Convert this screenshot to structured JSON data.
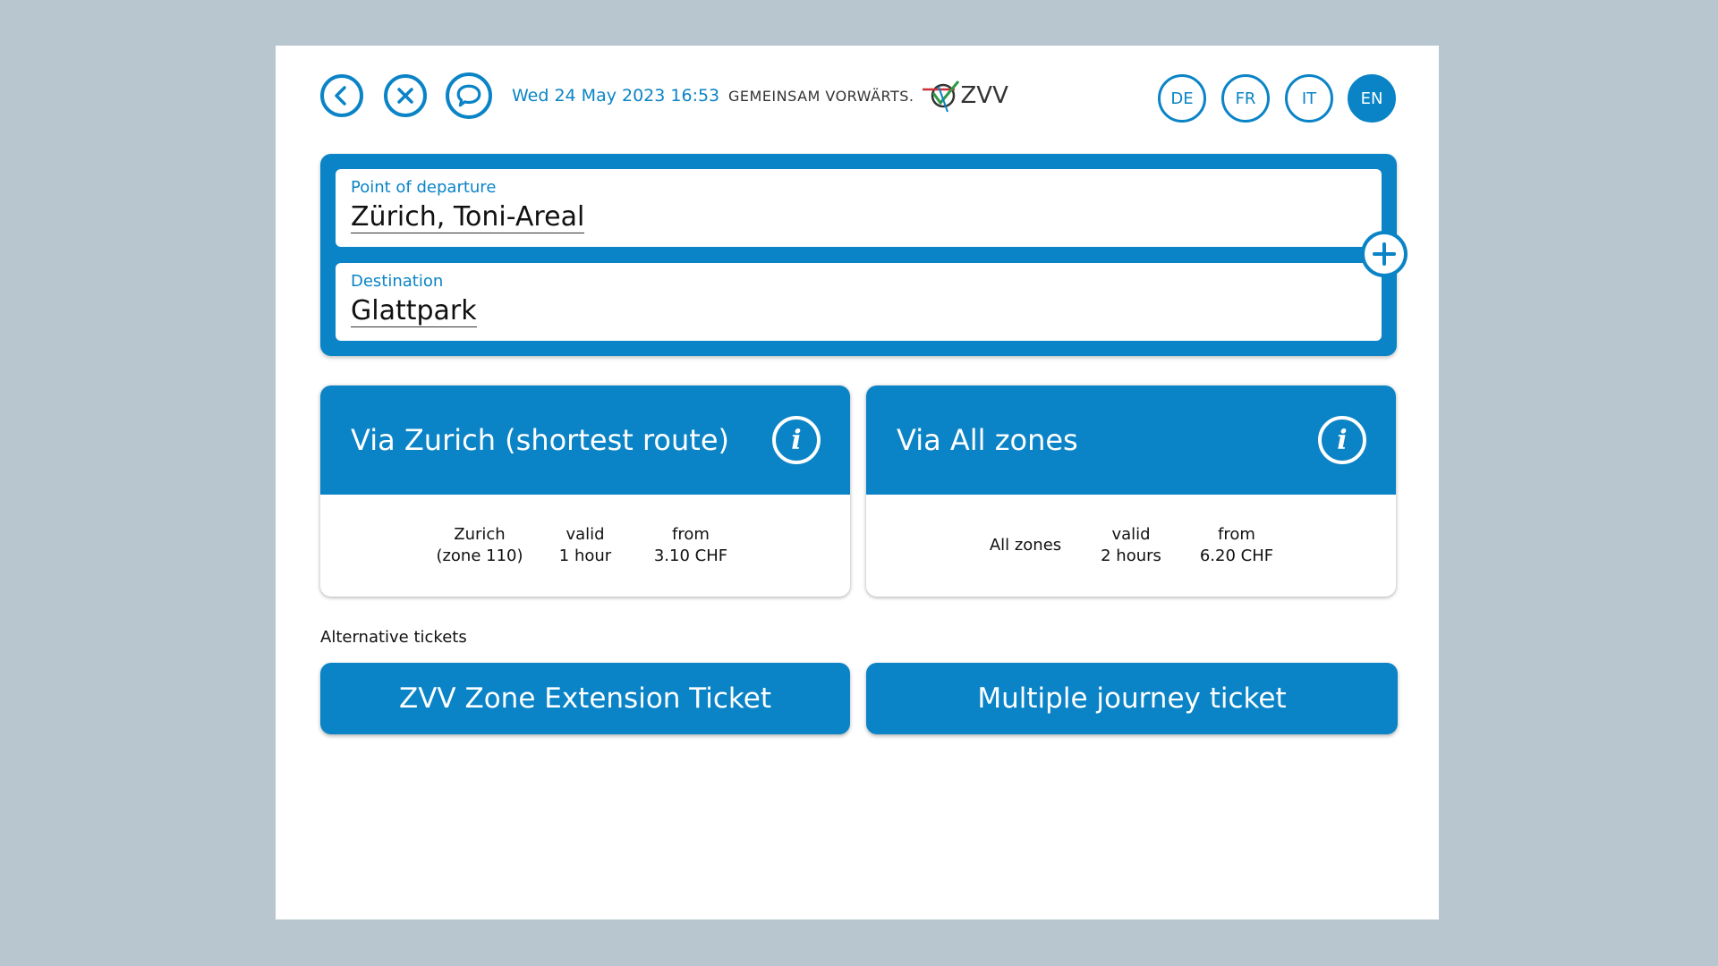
{
  "header": {
    "datetime": "Wed 24 May 2023 16:53",
    "brand_slogan": "GEMEINSAM VORWÄRTS.",
    "brand_logo_text": "ZVV",
    "languages": [
      "DE",
      "FR",
      "IT",
      "EN"
    ],
    "active_language": "EN",
    "icons": [
      "back-icon",
      "close-icon",
      "chat-icon"
    ]
  },
  "route": {
    "departure_label": "Point of departure",
    "departure_value": "Zürich, Toni-Areal",
    "destination_label": "Destination",
    "destination_value": "Glattpark",
    "add_icon": "plus-circle-icon"
  },
  "cards": [
    {
      "title": "Via Zurich (shortest route)",
      "zone_line1": "Zurich",
      "zone_line2": "(zone 110)",
      "valid_line1": "valid",
      "valid_line2": "1 hour",
      "price_line1": "from",
      "price_line2": "3.10 CHF"
    },
    {
      "title": "Via All zones",
      "zone_line1": "All zones",
      "valid_line1": "valid",
      "valid_line2": "2 hours",
      "price_line1": "from",
      "price_line2": "6.20 CHF"
    }
  ],
  "alternatives": {
    "label": "Alternative tickets",
    "buttons": [
      "ZVV Zone Extension Ticket",
      "Multiple journey ticket"
    ]
  },
  "colors": {
    "primary": "#0a84c6",
    "background": "#b8c6cf",
    "screen": "#ffffff"
  }
}
